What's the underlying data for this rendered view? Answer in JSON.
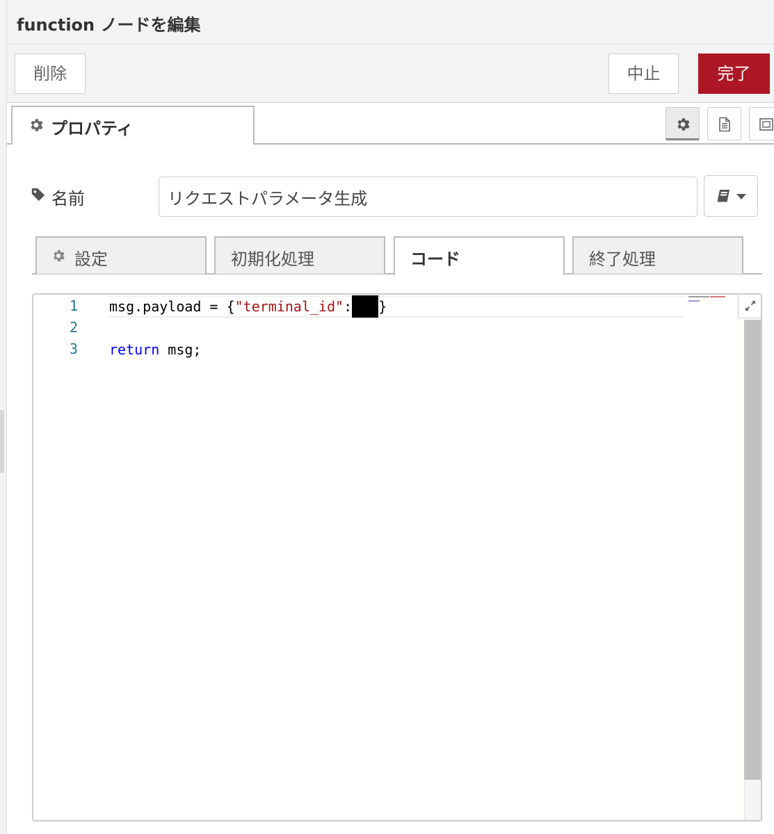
{
  "tray": {
    "title": "function ノードを編集"
  },
  "toolbar": {
    "delete_label": "削除",
    "cancel_label": "中止",
    "done_label": "完了"
  },
  "tabs": {
    "properties_label": "プロパティ",
    "side_buttons": [
      "gear-icon",
      "file-text-icon",
      "layout-icon"
    ]
  },
  "name_field": {
    "label": "名前",
    "value": "リクエストパラメータ生成"
  },
  "subtabs": [
    {
      "label": "設定",
      "active": false
    },
    {
      "label": "初期化処理",
      "active": false
    },
    {
      "label": "コード",
      "active": true
    },
    {
      "label": "終了処理",
      "active": false
    }
  ],
  "editor": {
    "line_numbers": [
      "1",
      "2",
      "3"
    ],
    "lines": [
      {
        "plain_1": "msg.payload = {",
        "string": "\"terminal_id\"",
        "plain_2": ":",
        "plain_3": "}"
      },
      {
        "text": ""
      },
      {
        "keyword": "return",
        "plain": " msg;"
      }
    ]
  },
  "colors": {
    "done_button": "#ad1625",
    "line_number": "#237893",
    "string": "#a31515",
    "keyword": "#0000ff"
  }
}
